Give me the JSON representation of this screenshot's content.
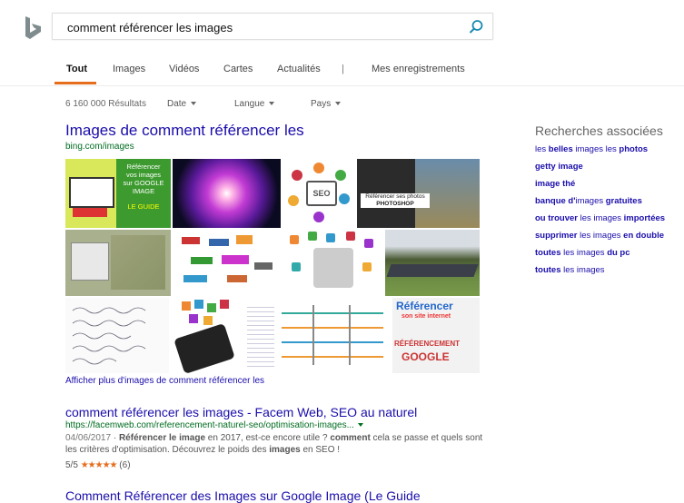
{
  "search": {
    "query": "comment référencer les images"
  },
  "nav": {
    "tabs": [
      {
        "label": "Tout"
      },
      {
        "label": "Images"
      },
      {
        "label": "Vidéos"
      },
      {
        "label": "Cartes"
      },
      {
        "label": "Actualités"
      },
      {
        "label": "Mes enregistrements"
      }
    ],
    "separator": "|"
  },
  "info": {
    "count": "6 160 000 Résultats",
    "filters": [
      {
        "label": "Date"
      },
      {
        "label": "Langue"
      },
      {
        "label": "Pays"
      }
    ]
  },
  "images_section": {
    "title": "Images de comment référencer les",
    "source": "bing.com/images",
    "thumb_texts": {
      "t1": [
        "Référencer",
        "vos images",
        "sur GOOGLE",
        "IMAGE",
        "LE GUIDE"
      ],
      "t4": [
        "Référencer ses photos",
        "PHOTOSHOP"
      ],
      "t11": [
        "Référencer",
        "son site internet",
        "RÉFÉRENCEMENT",
        "GOOGLE"
      ]
    },
    "more_link": "Afficher plus d'images de comment référencer les"
  },
  "result": {
    "title": "comment référencer les images - Facem Web, SEO au naturel",
    "url": "https://facemweb.com/referencement-naturel-seo/optimisation-images...",
    "date": "04/06/2017",
    "snippet_parts": [
      {
        "t": " · ",
        "b": false
      },
      {
        "t": "Référencer le image",
        "b": true
      },
      {
        "t": " en 2017, est-ce encore utile ? ",
        "b": false
      },
      {
        "t": "comment",
        "b": true
      },
      {
        "t": " cela se passe et quels sont les critères d'optimisation. Découvrez le poids des ",
        "b": false
      },
      {
        "t": "images",
        "b": true
      },
      {
        "t": " en SEO !",
        "b": false
      }
    ],
    "rating": "5/5",
    "stars": "★★★★★",
    "reviews": "(6)"
  },
  "result2": {
    "title": "Comment Référencer des Images sur Google Image (Le Guide"
  },
  "related": {
    "title": "Recherches associées",
    "items": [
      [
        {
          "t": "les ",
          "b": false
        },
        {
          "t": "belles",
          "b": true
        },
        {
          "t": " images les ",
          "b": false
        },
        {
          "t": "photos",
          "b": true
        }
      ],
      [
        {
          "t": "getty image",
          "b": true
        }
      ],
      [
        {
          "t": "image thé",
          "b": true
        }
      ],
      [
        {
          "t": "banque d'",
          "b": true
        },
        {
          "t": "images ",
          "b": false
        },
        {
          "t": "gratuites",
          "b": true
        }
      ],
      [
        {
          "t": "ou trouver",
          "b": true
        },
        {
          "t": " les images ",
          "b": false
        },
        {
          "t": "importées",
          "b": true
        }
      ],
      [
        {
          "t": "supprimer",
          "b": true
        },
        {
          "t": " les images ",
          "b": false
        },
        {
          "t": "en double",
          "b": true
        }
      ],
      [
        {
          "t": "toutes",
          "b": true
        },
        {
          "t": " les images ",
          "b": false
        },
        {
          "t": "du pc",
          "b": true
        }
      ],
      [
        {
          "t": "toutes",
          "b": true
        },
        {
          "t": " les images",
          "b": false
        }
      ]
    ]
  },
  "colors": {
    "accent": "#e66d1b",
    "link": "#1a0dab",
    "url": "#006d21",
    "bing_logo": "#7f8c8d"
  }
}
